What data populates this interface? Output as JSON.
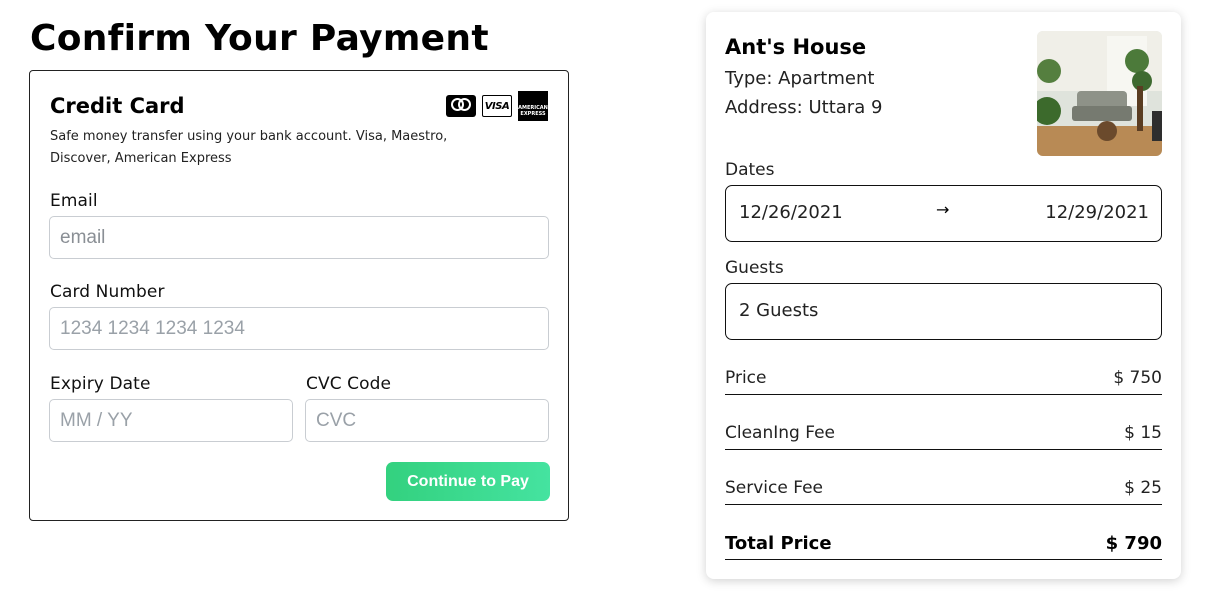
{
  "page": {
    "title": "Confirm Your Payment"
  },
  "payment": {
    "title": "Credit Card",
    "description": "Safe money transfer using your bank account. Visa, Maestro, Discover, American Express",
    "logos": [
      "mastercard-icon",
      "visa-icon",
      "amex-icon"
    ],
    "logo_text": {
      "visa": "VISA",
      "amex": "AMERICAN EXPRESS"
    },
    "email": {
      "label": "Email",
      "placeholder": "email",
      "value": ""
    },
    "card_number": {
      "label": "Card Number",
      "placeholder": "1234 1234 1234 1234",
      "value": ""
    },
    "expiry": {
      "label": "Expiry Date",
      "placeholder": "MM / YY",
      "value": ""
    },
    "cvc": {
      "label": "CVC Code",
      "placeholder": "CVC",
      "value": ""
    },
    "button_label": "Continue to Pay",
    "button_colors": [
      "#33d17f",
      "#45e3a0"
    ]
  },
  "summary": {
    "house_name": "Ant's House",
    "type": "Type: Apartment",
    "address": "Address: Uttara 9",
    "dates_label": "Dates",
    "date_from": "12/26/2021",
    "date_arrow": "→",
    "date_to": "12/29/2021",
    "guests_label": "Guests",
    "guests_value": "2 Guests",
    "lines": [
      {
        "label": "Price",
        "value": "$ 750"
      },
      {
        "label": "CleanIng Fee",
        "value": "$ 15"
      },
      {
        "label": "Service Fee",
        "value": "$ 25"
      }
    ],
    "total": {
      "label": "Total Price",
      "value": "$ 790"
    }
  }
}
